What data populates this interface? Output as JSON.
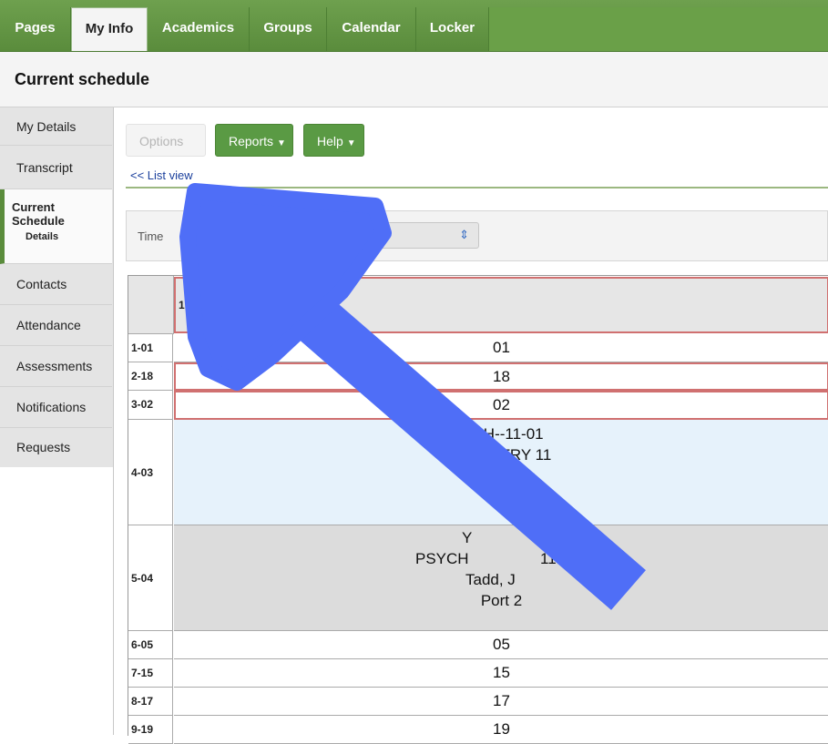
{
  "nav": {
    "tabs": [
      {
        "label": "Pages"
      },
      {
        "label": "My Info"
      },
      {
        "label": "Academics"
      },
      {
        "label": "Groups"
      },
      {
        "label": "Calendar"
      },
      {
        "label": "Locker"
      }
    ],
    "active_tab": "My Info"
  },
  "page_title": "Current schedule",
  "sidebar": {
    "items": [
      {
        "label": "My Details"
      },
      {
        "label": "Transcript"
      },
      {
        "label": "Current",
        "label2": "Schedule",
        "sub": "Details"
      },
      {
        "label": "Contacts"
      },
      {
        "label": "Attendance"
      },
      {
        "label": "Assessments"
      },
      {
        "label": "Notifications"
      },
      {
        "label": "Requests"
      }
    ]
  },
  "toolbar": {
    "options_label": "Options",
    "reports_label": "Reports",
    "help_label": "Help",
    "list_view_link": "<< List view"
  },
  "filter": {
    "label": "Time"
  },
  "schedule": {
    "day_header": "1 - 1",
    "rows": [
      {
        "period": "1-01",
        "lines": [
          "01"
        ]
      },
      {
        "period": "2-18",
        "lines": [
          "18"
        ]
      },
      {
        "period": "3-02",
        "lines": [
          "02"
        ]
      },
      {
        "period": "4-03",
        "lines": [
          "MCH--11-01",
          "HEMISTRY 11",
          ", Veronica",
          "0"
        ]
      },
      {
        "period": "5-04",
        "lines": [
          "Y",
          "03",
          "PSYCH",
          "11",
          "Tadd, J",
          "Port 2"
        ]
      },
      {
        "period": "6-05",
        "lines": [
          "05"
        ]
      },
      {
        "period": "7-15",
        "lines": [
          "15"
        ]
      },
      {
        "period": "8-17",
        "lines": [
          "17"
        ]
      },
      {
        "period": "9-19",
        "lines": [
          "19"
        ]
      }
    ]
  },
  "colors": {
    "nav_green": "#5a8c3c",
    "button_green": "#5a9a44",
    "highlight_red": "#d07070",
    "class_blue": "#e6f2fb",
    "class_gray": "#dcdcdc",
    "arrow_blue": "#4f6ef7"
  }
}
